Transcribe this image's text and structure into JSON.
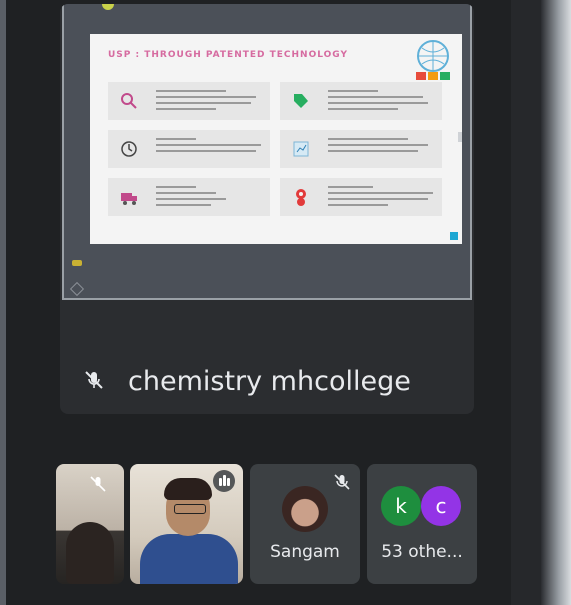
{
  "presentation": {
    "slide_title": "USP : THROUGH PATENTED TECHNOLOGY",
    "presenter_name": "chemistry mhcollege"
  },
  "participants": [
    {
      "name": "",
      "muted": true
    },
    {
      "name": "",
      "speaking": true
    },
    {
      "name": "Sangam",
      "muted": true
    },
    {
      "name": "53 othe...",
      "avatars": [
        "k",
        "c"
      ]
    }
  ],
  "colors": {
    "background": "#1f2123",
    "avatar_k": "#1e8e3e",
    "avatar_c": "#9334e6",
    "slide_title": "#d66ba0"
  },
  "icons": [
    "mic-off-icon",
    "speaking-icon",
    "pencil-icon",
    "logo-icon"
  ]
}
